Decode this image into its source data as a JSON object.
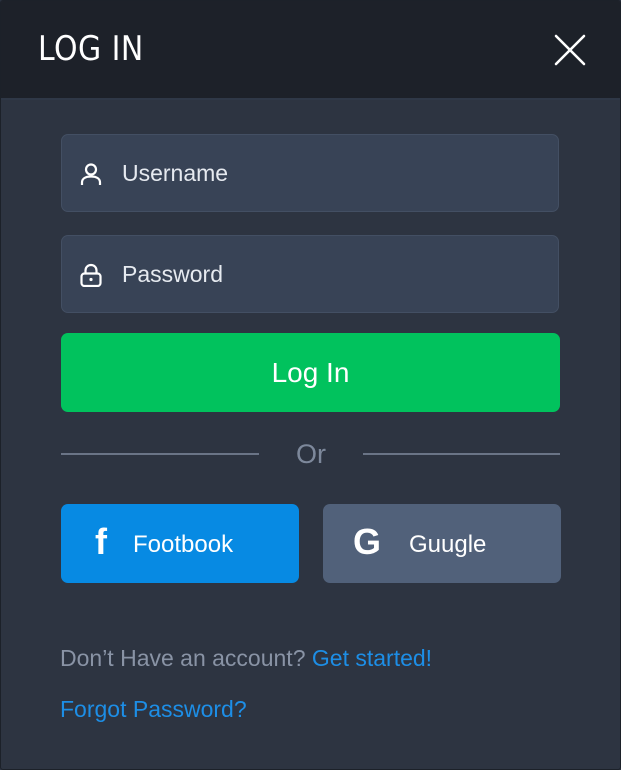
{
  "header": {
    "title": "LOG IN",
    "close_icon": "close-icon"
  },
  "form": {
    "username": {
      "placeholder": "Username",
      "value": "",
      "icon": "user-icon"
    },
    "password": {
      "placeholder": "Password",
      "value": "",
      "icon": "lock-icon"
    },
    "login_label": "Log In"
  },
  "divider": {
    "label": "Or"
  },
  "social": {
    "facebook": {
      "glyph": "f",
      "label": "Footbook",
      "color": "#078ae3"
    },
    "google": {
      "glyph": "G",
      "label": "Guugle",
      "color": "#51617a"
    }
  },
  "footer": {
    "no_account_text": "Don’t Have an account?",
    "get_started_link": "Get started!",
    "forgot_link": "Forgot Password?"
  },
  "colors": {
    "accent_green": "#01c25d",
    "link_blue": "#1d8ee6",
    "background": "#2d3441",
    "header": "#1d2129"
  }
}
